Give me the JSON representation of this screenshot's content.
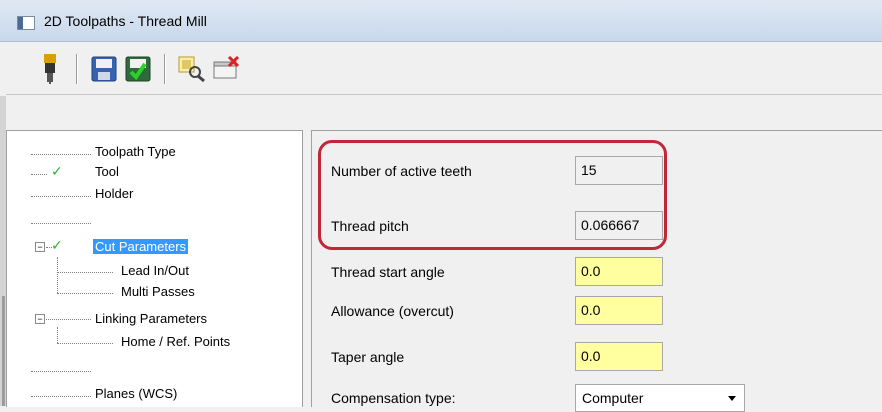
{
  "window": {
    "title": "2D Toolpaths - Thread Mill"
  },
  "toolbar": {
    "buttons": [
      {
        "icon": "tool-icon"
      },
      {
        "icon": "save-icon"
      },
      {
        "icon": "save-ok-icon"
      },
      {
        "icon": "view-icon"
      },
      {
        "icon": "delete-icon"
      }
    ]
  },
  "tree": {
    "items": [
      {
        "label": "Toolpath Type"
      },
      {
        "label": "Tool"
      },
      {
        "label": "Holder"
      },
      {
        "label": ""
      },
      {
        "label": "Cut Parameters"
      },
      {
        "label": "Lead In/Out"
      },
      {
        "label": "Multi Passes"
      },
      {
        "label": "Linking Parameters"
      },
      {
        "label": "Home / Ref. Points"
      },
      {
        "label": ""
      },
      {
        "label": "Planes (WCS)"
      }
    ],
    "check_mark": "✓",
    "expander": "−"
  },
  "params": {
    "active_teeth": {
      "label": "Number of active teeth",
      "value": "15"
    },
    "thread_pitch": {
      "label": "Thread pitch",
      "value": "0.066667"
    },
    "start_angle": {
      "label": "Thread start angle",
      "value": "0.0"
    },
    "allowance": {
      "label": "Allowance (overcut)",
      "value": "0.0"
    },
    "taper_angle": {
      "label": "Taper angle",
      "value": "0.0"
    },
    "compensation": {
      "label": "Compensation type:",
      "value": "Computer"
    }
  },
  "colors": {
    "highlight": "#c0283a",
    "input_yellow": "#ffffa0",
    "selection": "#3399ff"
  }
}
